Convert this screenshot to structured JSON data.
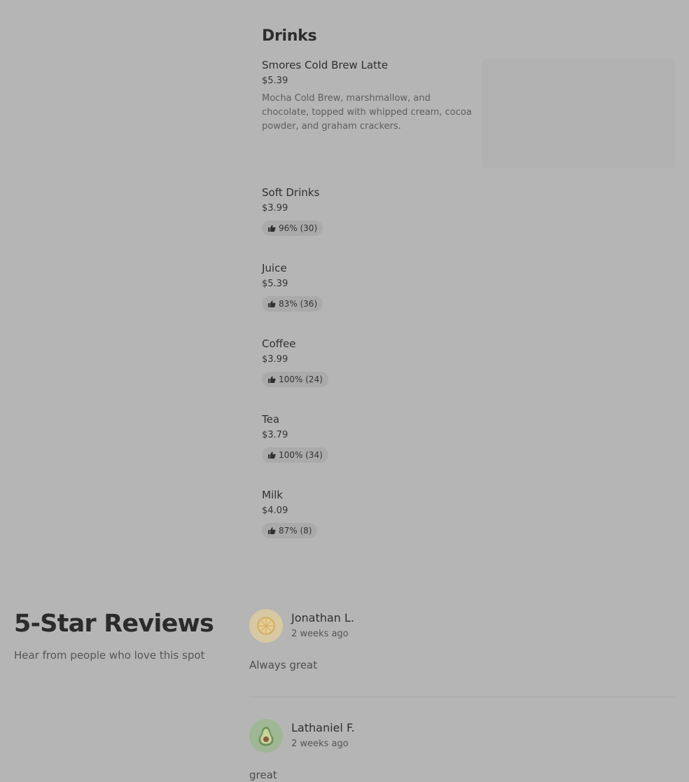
{
  "drinks": {
    "title": "Drinks",
    "items": [
      {
        "name": "Smores Cold Brew Latte",
        "price": "$5.39",
        "description": "Mocha Cold Brew, marshmallow, and chocolate, topped with whipped cream, cocoa powder, and graham crackers."
      },
      {
        "name": "Soft Drinks",
        "price": "$3.99",
        "rating": "96% (30)"
      },
      {
        "name": "Juice",
        "price": "$5.39",
        "rating": "83% (36)"
      },
      {
        "name": "Coffee",
        "price": "$3.99",
        "rating": "100% (24)"
      },
      {
        "name": "Tea",
        "price": "$3.79",
        "rating": "100% (34)"
      },
      {
        "name": "Milk",
        "price": "$4.09",
        "rating": "87% (8)"
      }
    ]
  },
  "reviews": {
    "title": "5-Star Reviews",
    "subtitle": "Hear from people who love this spot",
    "items": [
      {
        "name": "Jonathan L.",
        "time": "2 weeks ago",
        "text": "Always great",
        "avatar_icon": "lemon-slice-icon",
        "avatar_color": "#d8c9a3"
      },
      {
        "name": "Lathaniel F.",
        "time": "2 weeks ago",
        "text": "great",
        "avatar_icon": "avocado-icon",
        "avatar_color": "#9fb794"
      }
    ]
  },
  "colors": {
    "background": "#b5b5b5",
    "badge": "#aaaaaa",
    "text": "#2f2f2f"
  }
}
